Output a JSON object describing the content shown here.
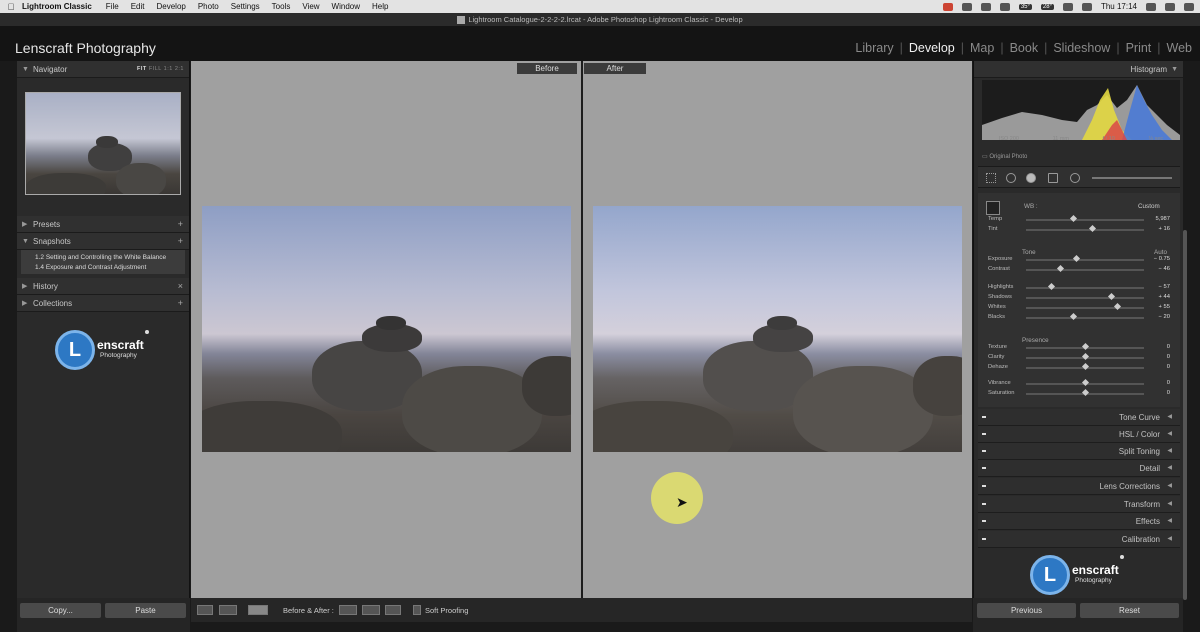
{
  "menubar": {
    "app_name": "Lightroom Classic",
    "items": [
      "File",
      "Edit",
      "Develop",
      "Photo",
      "Settings",
      "Tools",
      "View",
      "Window",
      "Help"
    ],
    "temp1": "35°",
    "temp2": "28°",
    "clock": "Thu 17:14"
  },
  "window": {
    "title": "Lightroom Catalogue-2-2-2-2.lrcat - Adobe Photoshop Lightroom Classic - Develop"
  },
  "identity": {
    "brand": "Lenscraft Photography"
  },
  "modules": {
    "library": "Library",
    "develop": "Develop",
    "map": "Map",
    "book": "Book",
    "slideshow": "Slideshow",
    "print": "Print",
    "web": "Web",
    "active": "Develop"
  },
  "left": {
    "navigator": {
      "label": "Navigator",
      "fit": "FIT",
      "fill": "FILL",
      "one": "1:1",
      "ratio": "2:1"
    },
    "presets": "Presets",
    "snapshots": {
      "label": "Snapshots",
      "items": [
        "1.2 Setting and Controlling the White Balance",
        "1.4 Exposure and Contrast Adjustment"
      ]
    },
    "history": "History",
    "collections": "Collections",
    "logo": {
      "letter": "L",
      "name": "enscraft",
      "sub": "Photography"
    },
    "copy_button": "Copy...",
    "paste_button": "Paste"
  },
  "center": {
    "before_label": "Before",
    "after_label": "After",
    "toolbar": {
      "before_after": "Before & After :",
      "soft_proofing": "Soft Proofing"
    }
  },
  "right": {
    "histogram": {
      "label": "Histogram",
      "iso": "ISO 200",
      "focal": "11 mm",
      "aperture": "f / 10",
      "shutter": "⅛ sec",
      "original_photo": "Original Photo"
    },
    "basic": {
      "wb_label": "WB :",
      "wb_value": "Custom",
      "tone_label": "Tone",
      "auto_label": "Auto",
      "presence_label": "Presence",
      "sliders": [
        {
          "name": "Temp",
          "value": "5,987",
          "pos": 0.4
        },
        {
          "name": "Tint",
          "value": "+ 16",
          "pos": 0.56
        },
        {
          "name": "Exposure",
          "value": "− 0.75",
          "pos": 0.42
        },
        {
          "name": "Contrast",
          "value": "− 46",
          "pos": 0.29
        },
        {
          "name": "Highlights",
          "value": "− 57",
          "pos": 0.21
        },
        {
          "name": "Shadows",
          "value": "+ 44",
          "pos": 0.72
        },
        {
          "name": "Whites",
          "value": "+ 55",
          "pos": 0.77
        },
        {
          "name": "Blacks",
          "value": "− 20",
          "pos": 0.4
        },
        {
          "name": "Texture",
          "value": "0",
          "pos": 0.5
        },
        {
          "name": "Clarity",
          "value": "0",
          "pos": 0.5
        },
        {
          "name": "Dehaze",
          "value": "0",
          "pos": 0.5
        },
        {
          "name": "Vibrance",
          "value": "0",
          "pos": 0.5
        },
        {
          "name": "Saturation",
          "value": "0",
          "pos": 0.5
        }
      ]
    },
    "panels": [
      "Tone Curve",
      "HSL / Color",
      "Split Toning",
      "Detail",
      "Lens Corrections",
      "Transform",
      "Effects",
      "Calibration"
    ],
    "logo": {
      "letter": "L",
      "name": "enscraft",
      "sub": "Photography"
    },
    "previous_button": "Previous",
    "reset_button": "Reset"
  }
}
